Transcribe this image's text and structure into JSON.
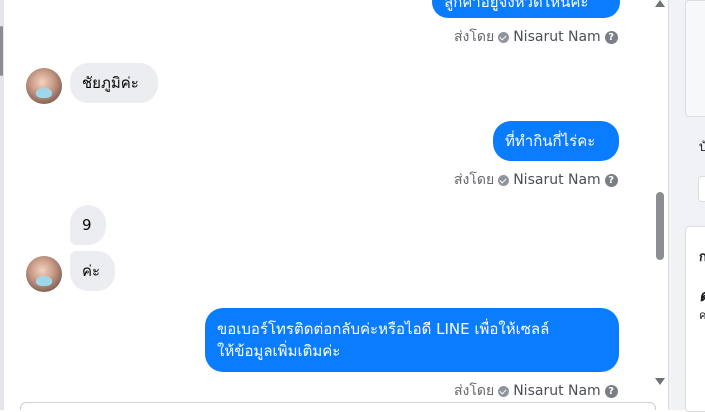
{
  "messages": {
    "top_out": {
      "text": "ลูกค้าอยู่จังหวัดไหนคะ"
    },
    "in1": {
      "text": "ชัยภูมิค่ะ"
    },
    "out2": {
      "text": "ที่ทำกินกี่ไร่คะ"
    },
    "in2a": {
      "text": "9"
    },
    "in2b": {
      "text": "ค่ะ"
    },
    "out3": {
      "line1": "ขอเบอร์โทรติดต่อกลับค่ะหรือไอดี LINE เพื่อให้เซลล์",
      "line2": "ให้ข้อมูลเพิ่มเติมค่ะ"
    }
  },
  "sent_by": {
    "prefix": "ส่งโดย",
    "name": "Nisarut Nam",
    "help": "?"
  },
  "right_panel": {
    "label1": "บั",
    "label2": "ก",
    "label3": "ต",
    "label4": "ค"
  },
  "colors": {
    "outgoing": "#0a7cff",
    "incoming": "#ebedf0"
  }
}
